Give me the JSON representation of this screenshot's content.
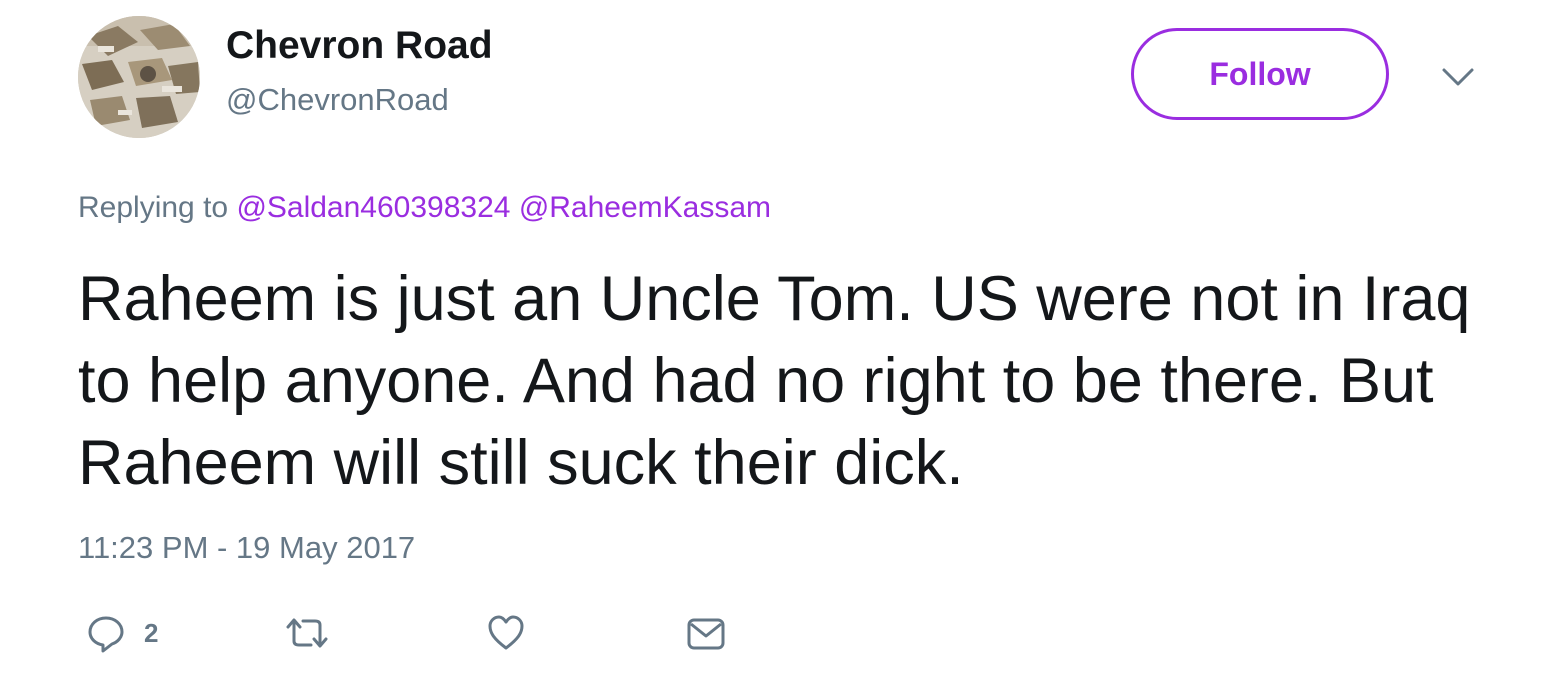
{
  "tweet": {
    "author": {
      "display_name": "Chevron Road",
      "handle": "@ChevronRoad"
    },
    "follow_label": "Follow",
    "replying_prefix": "Replying to",
    "mentions": [
      "@Saldan460398324",
      "@RaheemKassam"
    ],
    "text": "Raheem is just an Uncle Tom. US were not in Iraq to help anyone. And had no right to be there. But Raheem will still suck their dick.",
    "timestamp": "11:23 PM - 19 May 2017",
    "reply_count": "2"
  },
  "icons": [
    "avatar-image",
    "chevron-down-icon",
    "reply-icon",
    "retweet-icon",
    "like-icon",
    "message-icon"
  ],
  "colors": {
    "accent": "#9a2de0",
    "secondary_text": "#657786",
    "primary_text": "#14171a"
  }
}
